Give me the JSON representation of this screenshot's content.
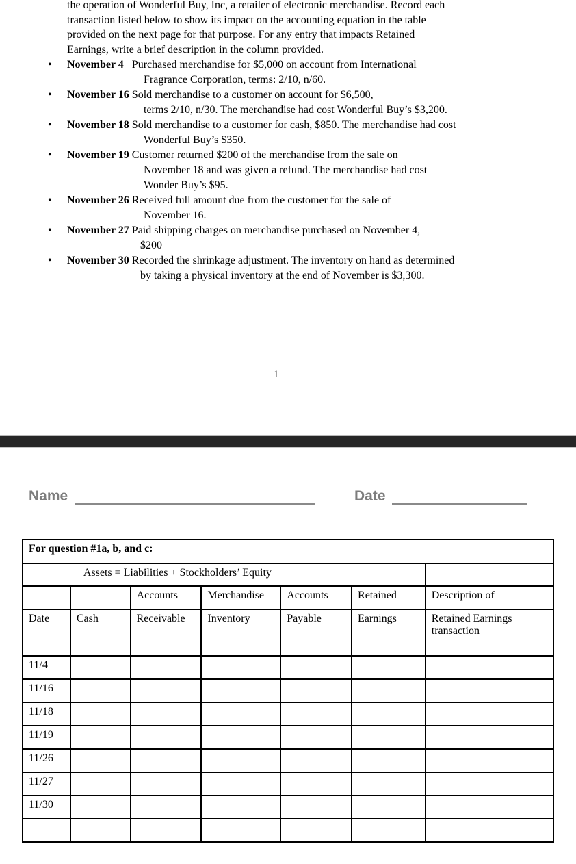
{
  "page1": {
    "intro_lines": [
      "the operation of Wonderful Buy, Inc, a retailer of electronic merchandise.   Record each",
      "transaction listed below to show its impact on the accounting equation in the table",
      "provided on the next page for that purpose.  For any entry that impacts Retained",
      "Earnings, write a brief description in the column provided."
    ],
    "transactions": [
      {
        "date": "November 4",
        "lines": [
          "Purchased merchandise for $5,000 on account from International",
          "Fragrance Corporation, terms: 2/10, n/60."
        ]
      },
      {
        "date": "November 16",
        "lines": [
          "Sold merchandise to a customer on account for $6,500,",
          "terms 2/10, n/30.  The merchandise had cost Wonderful Buy’s $3,200."
        ]
      },
      {
        "date": "November 18",
        "lines": [
          "Sold merchandise to a customer for cash, $850. The merchandise had cost",
          "Wonderful Buy’s $350."
        ]
      },
      {
        "date": "November 19",
        "lines": [
          "Customer returned $200 of the merchandise from the sale on",
          "November 18 and was given a refund.  The merchandise had cost",
          "Wonder Buy’s $95."
        ]
      },
      {
        "date": "November 26",
        "lines": [
          "Received full amount due from the customer for the sale of",
          "November 16."
        ]
      },
      {
        "date": "November 27",
        "lines": [
          "Paid shipping charges on merchandise purchased on November 4,",
          "$200"
        ]
      },
      {
        "date": "November 30",
        "lines": [
          "Recorded the shrinkage adjustment. The inventory on hand as determined",
          "by taking a physical inventory at the end of November is $3,300."
        ]
      }
    ],
    "bullet_icon": "•",
    "page_number": "1"
  },
  "page2": {
    "name_label": "Name",
    "date_label": "Date",
    "table": {
      "title": "For question #1a, b, and c:",
      "equation": "Assets = Liabilities + Stockholders’ Equity",
      "header_row1": [
        "",
        "",
        "Accounts",
        "Merchandise",
        "Accounts",
        "Retained",
        "Description of"
      ],
      "header_row2": [
        "Date",
        "Cash",
        "Receivable",
        "Inventory",
        "Payable",
        "Earnings",
        "Retained Earnings transaction"
      ],
      "rows": [
        [
          "11/4",
          "",
          "",
          "",
          "",
          "",
          ""
        ],
        [
          "11/16",
          "",
          "",
          "",
          "",
          "",
          ""
        ],
        [
          "11/18",
          "",
          "",
          "",
          "",
          "",
          ""
        ],
        [
          "11/19",
          "",
          "",
          "",
          "",
          "",
          ""
        ],
        [
          "11/26",
          "",
          "",
          "",
          "",
          "",
          ""
        ],
        [
          "11/27",
          "",
          "",
          "",
          "",
          "",
          ""
        ],
        [
          "11/30",
          "",
          "",
          "",
          "",
          "",
          ""
        ],
        [
          "",
          "",
          "",
          "",
          "",
          "",
          ""
        ]
      ]
    }
  }
}
